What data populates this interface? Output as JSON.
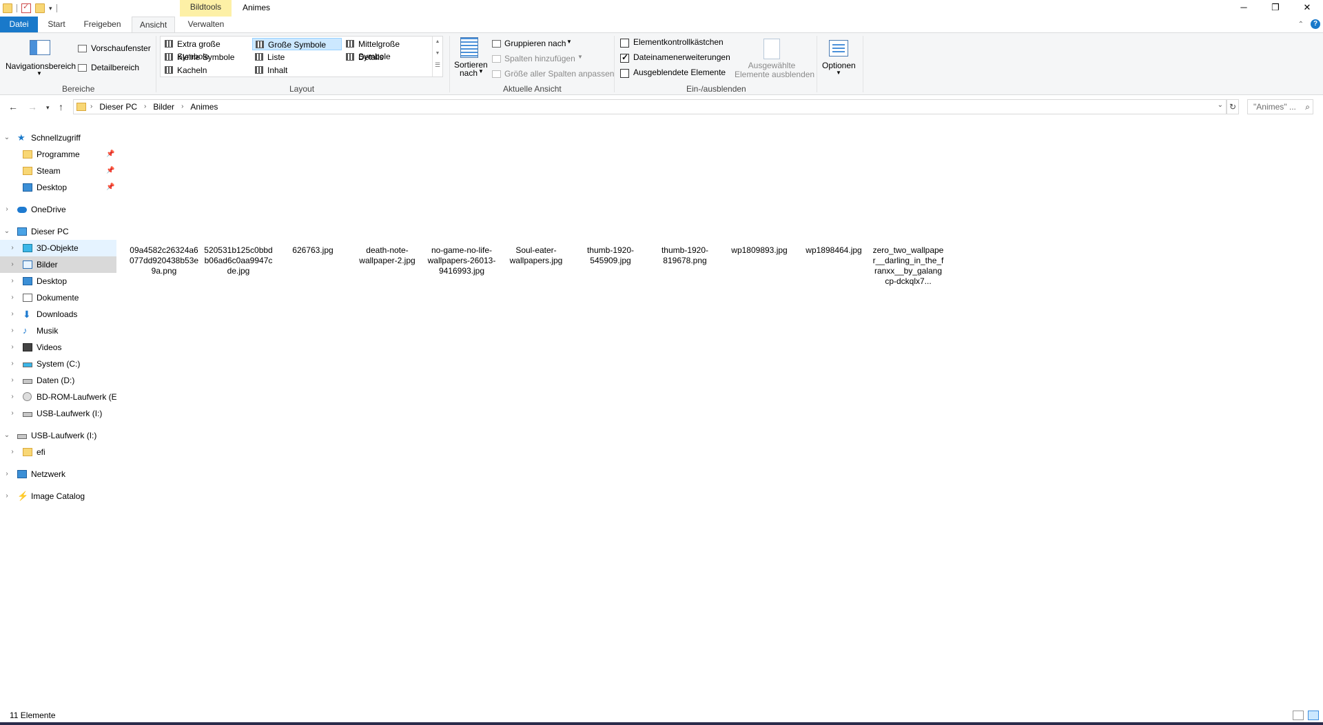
{
  "window": {
    "title": "Animes",
    "context_tab": "Bildtools",
    "controls": {
      "minimize": "─",
      "maximize": "❐",
      "close": "✕"
    }
  },
  "ribbon_tabs": [
    {
      "label": "Datei"
    },
    {
      "label": "Start"
    },
    {
      "label": "Freigeben"
    },
    {
      "label": "Ansicht"
    },
    {
      "label": "Verwalten"
    }
  ],
  "ribbon": {
    "bereiche": {
      "group_label": "Bereiche",
      "nav_pane": "Navigationsbereich",
      "preview": "Vorschaufenster",
      "details_pane": "Detailbereich"
    },
    "layout": {
      "group_label": "Layout",
      "items": [
        "Extra große Symbole",
        "Große Symbole",
        "Mittelgroße Symbole",
        "Kleine Symbole",
        "Liste",
        "Details",
        "Kacheln",
        "Inhalt"
      ],
      "selected": "Große Symbole"
    },
    "current_view": {
      "group_label": "Aktuelle Ansicht",
      "sort": [
        "Sortieren",
        "nach"
      ],
      "group_by": "Gruppieren nach",
      "add_columns": "Spalten hinzufügen",
      "fit_columns": "Größe aller Spalten anpassen"
    },
    "show_hide": {
      "group_label": "Ein-/ausblenden",
      "checkboxes": [
        {
          "label": "Elementkontrollkästchen",
          "checked": false
        },
        {
          "label": "Dateinamenerweiterungen",
          "checked": true
        },
        {
          "label": "Ausgeblendete Elemente",
          "checked": false
        }
      ],
      "hide_selected": [
        "Ausgewählte",
        "Elemente ausblenden"
      ]
    },
    "options": {
      "label": "Optionen"
    }
  },
  "address": {
    "breadcrumbs": [
      "Dieser PC",
      "Bilder",
      "Animes"
    ],
    "search_placeholder": "\"Animes\" ..."
  },
  "nav_pane": [
    {
      "label": "Schnellzugriff",
      "icon": "star-icon",
      "level": 0,
      "expanded": true
    },
    {
      "label": "Programme",
      "icon": "folder-icon",
      "level": 1,
      "pinned": true
    },
    {
      "label": "Steam",
      "icon": "folder-icon",
      "level": 1,
      "pinned": true
    },
    {
      "label": "Desktop",
      "icon": "desktop-icon",
      "level": 1,
      "pinned": true
    },
    {
      "label": "OneDrive",
      "icon": "cloud-icon",
      "level": 0,
      "expanded": false
    },
    {
      "label": "Dieser PC",
      "icon": "pc-icon",
      "level": 0,
      "expanded": true
    },
    {
      "label": "3D-Objekte",
      "icon": "3d-objects-icon",
      "level": 1,
      "expanded": false,
      "state": "hover"
    },
    {
      "label": "Bilder",
      "icon": "pictures-icon",
      "level": 1,
      "expanded": false,
      "state": "selected"
    },
    {
      "label": "Desktop",
      "icon": "desktop-icon",
      "level": 1,
      "expanded": false
    },
    {
      "label": "Dokumente",
      "icon": "documents-icon",
      "level": 1,
      "expanded": false
    },
    {
      "label": "Downloads",
      "icon": "download-icon",
      "level": 1,
      "expanded": false
    },
    {
      "label": "Musik",
      "icon": "music-icon",
      "level": 1,
      "expanded": false
    },
    {
      "label": "Videos",
      "icon": "video-icon",
      "level": 1,
      "expanded": false
    },
    {
      "label": "System (C:)",
      "icon": "system-drive-icon",
      "level": 1,
      "expanded": false
    },
    {
      "label": "Daten (D:)",
      "icon": "drive-icon",
      "level": 1,
      "expanded": false
    },
    {
      "label": "BD-ROM-Laufwerk (E:",
      "icon": "bd-rom-icon",
      "level": 1,
      "expanded": false
    },
    {
      "label": "USB-Laufwerk (I:)",
      "icon": "drive-icon",
      "level": 1,
      "expanded": false
    },
    {
      "label": "USB-Laufwerk (I:)",
      "icon": "drive-icon",
      "level": 0,
      "expanded": true
    },
    {
      "label": "efi",
      "icon": "folder-icon",
      "level": 1,
      "expanded": false
    },
    {
      "label": "Netzwerk",
      "icon": "network-icon",
      "level": 0,
      "expanded": false
    },
    {
      "label": "Image Catalog",
      "icon": "image-catalog-icon",
      "level": 0,
      "expanded": false
    }
  ],
  "files": [
    "09a4582c26324a6077dd920438b53e9a.png",
    "520531b125c0bbdb06ad6c0aa9947cde.jpg",
    "626763.jpg",
    "death-note-wallpaper-2.jpg",
    "no-game-no-life-wallpapers-26013-9416993.jpg",
    "Soul-eater-wallpapers.jpg",
    "thumb-1920-545909.jpg",
    "thumb-1920-819678.png",
    "wp1809893.jpg",
    "wp1898464.jpg",
    "zero_two_wallpaper__darling_in_the_franxx__by_galangcp-dckqlx7..."
  ],
  "status": {
    "count": "11 Elemente"
  },
  "colors": {
    "accent": "#1979ca",
    "context_tab": "#fdf0a6",
    "selection": "#cce8ff",
    "ribbon_bg": "#f5f6f7"
  }
}
